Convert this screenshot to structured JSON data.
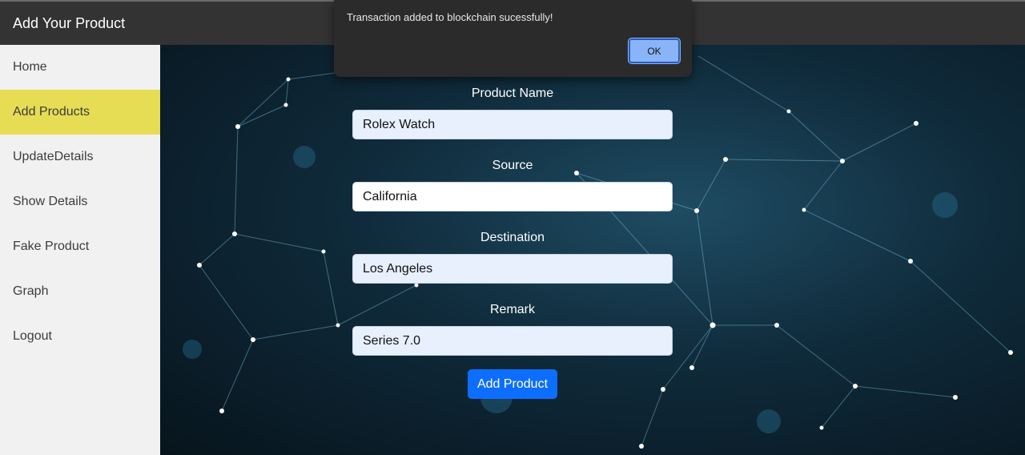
{
  "header": {
    "title": "Add Your Product"
  },
  "sidebar": {
    "items": [
      {
        "label": "Home"
      },
      {
        "label": "Add Products",
        "active": true
      },
      {
        "label": "UpdateDetails"
      },
      {
        "label": "Show Details"
      },
      {
        "label": "Fake Product"
      },
      {
        "label": "Graph"
      },
      {
        "label": "Logout"
      }
    ],
    "active_color": "#e6dd55"
  },
  "form": {
    "product_name": {
      "label": "Product Name",
      "value": "Rolex Watch"
    },
    "source": {
      "label": "Source",
      "value": "California"
    },
    "destination": {
      "label": "Destination",
      "value": "Los Angeles"
    },
    "remark": {
      "label": "Remark",
      "value": "Series 7.0"
    },
    "submit_label": "Add Product"
  },
  "alert": {
    "message": "Transaction added to blockchain sucessfully!",
    "ok_label": "OK"
  },
  "colors": {
    "header_bg": "#333333",
    "button_primary": "#0d6efd",
    "alert_ok": "#8ab4f8"
  }
}
